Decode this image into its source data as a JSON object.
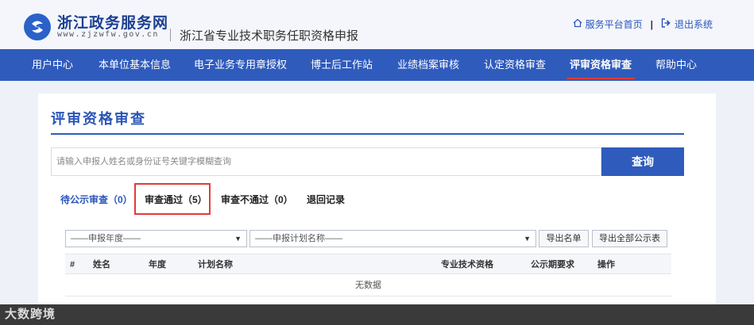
{
  "header": {
    "brand": "浙江政务服务网",
    "url": "www.zjzwfw.gov.cn",
    "subtitle": "浙江省专业技术职务任职资格申报",
    "links": {
      "home": "服务平台首页",
      "separator": "|",
      "logout": "退出系统"
    }
  },
  "nav": {
    "items": [
      {
        "label": "用户中心"
      },
      {
        "label": "本单位基本信息"
      },
      {
        "label": "电子业务专用章授权"
      },
      {
        "label": "博士后工作站"
      },
      {
        "label": "业绩档案审核"
      },
      {
        "label": "认定资格审查"
      },
      {
        "label": "评审资格审查",
        "active": true
      },
      {
        "label": "帮助中心"
      }
    ]
  },
  "main": {
    "title": "评审资格审查",
    "search": {
      "placeholder": "请输入申报人姓名或身份证号关键字模糊查询",
      "button": "查询"
    },
    "tabs": [
      {
        "label": "待公示审查（0）"
      },
      {
        "label": "审查通过（5）",
        "highlighted": true
      },
      {
        "label": "审查不通过（0）"
      },
      {
        "label": "退回记录"
      }
    ],
    "filters": {
      "year_select": "——申报年度——",
      "plan_select": "——申报计划名称——",
      "export_list": "导出名单",
      "export_all": "导出全部公示表"
    },
    "table": {
      "columns": [
        "#",
        "姓名",
        "年度",
        "计划名称",
        "专业技术资格",
        "公示期要求",
        "操作"
      ],
      "empty_text": "无数据"
    }
  },
  "watermark": "大数跨境",
  "colors": {
    "primary": "#2f5bbd",
    "highlight": "#e23b3b",
    "background": "#eef2f8"
  }
}
